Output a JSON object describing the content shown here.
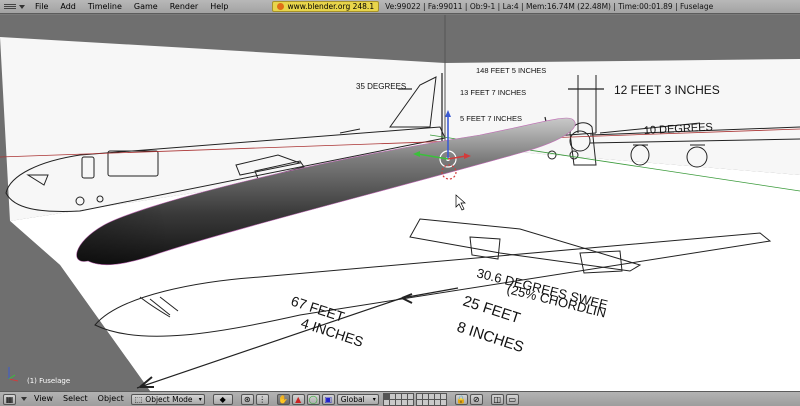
{
  "top_menu": [
    "File",
    "Add",
    "Timeline",
    "Game",
    "Render",
    "Help"
  ],
  "info_bar": {
    "site": "www.blender.org 248.1",
    "stats": "Ve:99022 | Fa:99011 | Ob:9-1 | La:4  | Mem:16.74M (22.48M)  | Time:00:01.89 | Fuselage"
  },
  "viewport": {
    "object_label": "(1) Fuselage",
    "blueprint_text": {
      "deg35": "35 DEGREES",
      "span": "148 FEET 5 INCHES",
      "ft13": "13 FEET 7 INCHES",
      "ft5": "5 FEET 7 INCHES",
      "ft12": "12 FEET 3 INCHES",
      "deg10": "10 DEGREES",
      "sweep1": "30.6 DEGREES SWEE",
      "sweep2": "(25% CHORDLIN",
      "ft67a": "67 FEET",
      "ft67b": "4 INCHES",
      "ft25a": "25 FEET",
      "ft25b": "8 INCHES"
    }
  },
  "bottom_bar": {
    "menu": [
      "View",
      "Select",
      "Object"
    ],
    "mode": "Object Mode",
    "orientation": "Global"
  },
  "colors": {
    "header_bg": "#a9a9a9",
    "viewport_bg": "#6f6f6f",
    "site_badge": "#e8d54b",
    "x_axis": "#d23b3b",
    "y_axis": "#3bbf3b",
    "z_axis": "#3b5bd2"
  }
}
